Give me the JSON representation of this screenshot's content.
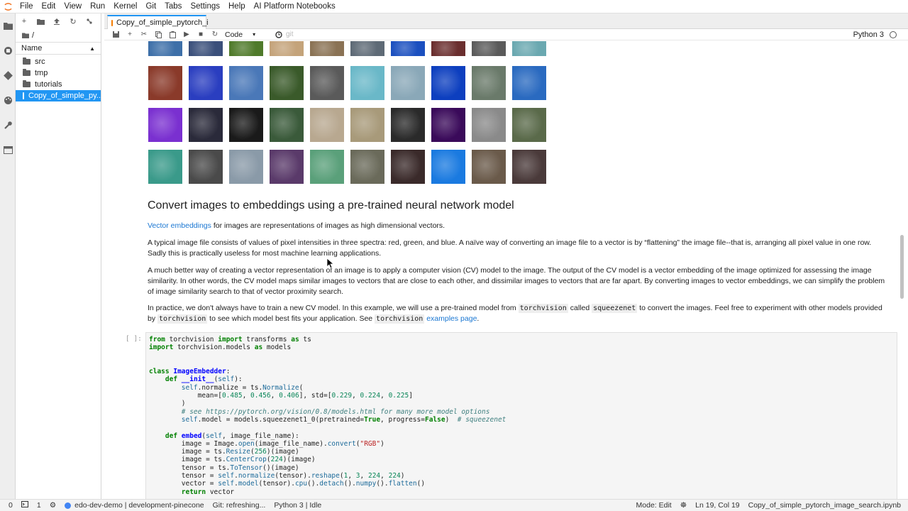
{
  "menubar": {
    "items": [
      "File",
      "Edit",
      "View",
      "Run",
      "Kernel",
      "Git",
      "Tabs",
      "Settings",
      "Help",
      "AI Platform Notebooks"
    ]
  },
  "filebrowser": {
    "path": "/",
    "column_name": "Name",
    "items": [
      {
        "name": "src",
        "type": "folder"
      },
      {
        "name": "tmp",
        "type": "folder"
      },
      {
        "name": "tutorials",
        "type": "folder"
      },
      {
        "name": "Copy_of_simple_py...",
        "type": "notebook",
        "selected": true
      }
    ]
  },
  "tab": {
    "title": "Copy_of_simple_pytorch_i"
  },
  "toolbar": {
    "cell_type": "Code",
    "git_label": "git",
    "kernel": "Python 3"
  },
  "notebook": {
    "heading": "Convert images to embeddings using a pre-trained neural network model",
    "p1_link": "Vector embeddings",
    "p1_rest": " for images are representations of images as high dimensional vectors.",
    "p2": "A typical image file consists of values of pixel intensities in three spectra: red, green, and blue. A naïve way of converting an image file to a vector is by “flattening” the image file--that is, arranging all pixel value in one row. Sadly this is practically useless for most machine learning applications.",
    "p3": "A much better way of creating a vector representation of an image is to apply a computer vision (CV) model to the image. The output of the CV model is a vector embedding of the image optimized for assessing the image similarity. In other words, the CV model maps similar images to vectors that are close to each other, and dissimilar images to vectors that are far apart. By converting images to vector embeddings, we can simplify the problem of image similarity search to that of vector proximity search.",
    "p4_a": "In practice, we don't always have to train a new CV model. In this example, we will use a pre-trained model from ",
    "p4_code1": "torchvision",
    "p4_b": " called ",
    "p4_code2": "squeezenet",
    "p4_c": " to convert the images. Feel free to experiment with other models provided by ",
    "p4_code3": "torchvision",
    "p4_d": " to see which model best fits your application. See ",
    "p4_code4": "torchvision",
    "p4_link": "examples page",
    "p4_end": ".",
    "cell_prompt": "[ ]:"
  },
  "thumbnail_colors": [
    [
      "#3d6fa8",
      "#3a4f7a",
      "#4f7a2a",
      "#c4a37a",
      "#8a7254",
      "#5e6a76",
      "#1b4fbf",
      "#6a2e2e",
      "#5a5a5a",
      "#6aa8b0"
    ],
    [
      "#8a3a2a",
      "#2a3ec0",
      "#4a78b8",
      "#3a5a2a",
      "#5a5a5a",
      "#6ab8c8",
      "#8aa8b8",
      "#0d3fbf",
      "#6a7a6a",
      "#2a6ac0"
    ],
    [
      "#7a30d0",
      "#2a2a3a",
      "#1a1a1a",
      "#3a5a3a",
      "#b8a890",
      "#a89a7a",
      "#2a2a2a",
      "#3a0a5a",
      "#8a8a8a",
      "#5a6a4a"
    ],
    [
      "#3a9a8a",
      "#4a4a4a",
      "#8a9aa8",
      "#5a3a6a",
      "#5aa07a",
      "#6a6a5a",
      "#3a2a2a",
      "#1a7ae0",
      "#6a5a4a",
      "#4a3a3a"
    ]
  ],
  "statusbar": {
    "count_a": "0",
    "count_b": "1",
    "remote": "edo-dev-demo | development-pinecone",
    "git": "Git: refreshing...",
    "kernel": "Python 3 | Idle",
    "mode": "Mode: Edit",
    "position": "Ln 19, Col 19",
    "file": "Copy_of_simple_pytorch_image_search.ipynb"
  }
}
